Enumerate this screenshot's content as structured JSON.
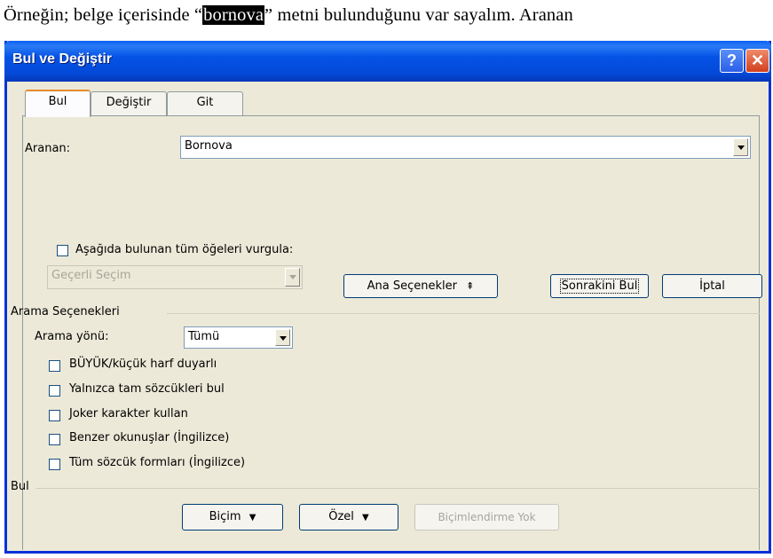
{
  "document": {
    "before": "Örneğin; belge içerisinde “",
    "highlight": "bornova",
    "after": "” metni bulunduğunu var sayalım. Aranan"
  },
  "dialog": {
    "title": "Bul ve Değiştir",
    "help_glyph": "?",
    "close_glyph": "✕",
    "tabs": {
      "find": {
        "label": "Bul"
      },
      "replace": {
        "label": "Değiştir"
      },
      "goto": {
        "label": "Git"
      }
    },
    "search_label": "Aranan:",
    "search_value": "Bornova",
    "highlight_all_label": "Aşağıda bulunan tüm öğeleri vurgula:",
    "scope_value": "Geçerli Seçim",
    "buttons": {
      "less": "Ana Seçenekler",
      "less_glyph": "⇞",
      "find_next": "Sonrakini Bul",
      "cancel": "İptal",
      "format": "Biçim",
      "special": "Özel",
      "no_format": "Biçimlendirme Yok"
    },
    "search_options_title": "Arama Seçenekleri",
    "direction_label": "Arama yönü:",
    "direction_value": "Tümü",
    "options": [
      "BÜYÜK/küçük harf duyarlı",
      "Yalnızca tam sözcükleri bul",
      "Joker karakter kullan",
      "Benzer okunuşlar (İngilizce)",
      "Tüm sözcük formları (İngilizce)"
    ],
    "find_section_title": "Bul"
  },
  "colors": {
    "titlebar": "#0553e6",
    "dialog_bg": "#ece9d8",
    "tab_accent": "#e68b2c"
  }
}
